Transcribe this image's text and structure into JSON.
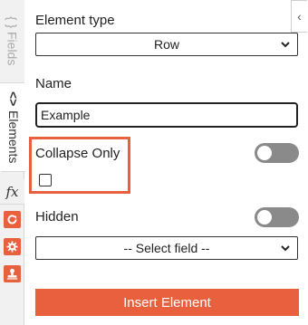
{
  "sidebar": {
    "tabs": [
      {
        "label": "Fields",
        "icon": "{ }"
      },
      {
        "label": "Elements",
        "icon": "<>"
      },
      {
        "label": "",
        "icon": "fx"
      }
    ],
    "icon_buttons": [
      "refresh-icon",
      "gear-icon",
      "stamp-icon"
    ]
  },
  "panel": {
    "collapse_icon": "‹",
    "element_type": {
      "label": "Element type",
      "value": "Row"
    },
    "name": {
      "label": "Name",
      "value": "Example"
    },
    "collapse_only": {
      "label": "Collapse Only",
      "checked": false,
      "toggle_on": false
    },
    "hidden": {
      "label": "Hidden",
      "toggle_on": false
    },
    "field_select": {
      "value": "-- Select field --"
    },
    "insert_button": "Insert Element"
  },
  "colors": {
    "accent": "#e9603f",
    "toggle_off": "#8a8a8a"
  }
}
